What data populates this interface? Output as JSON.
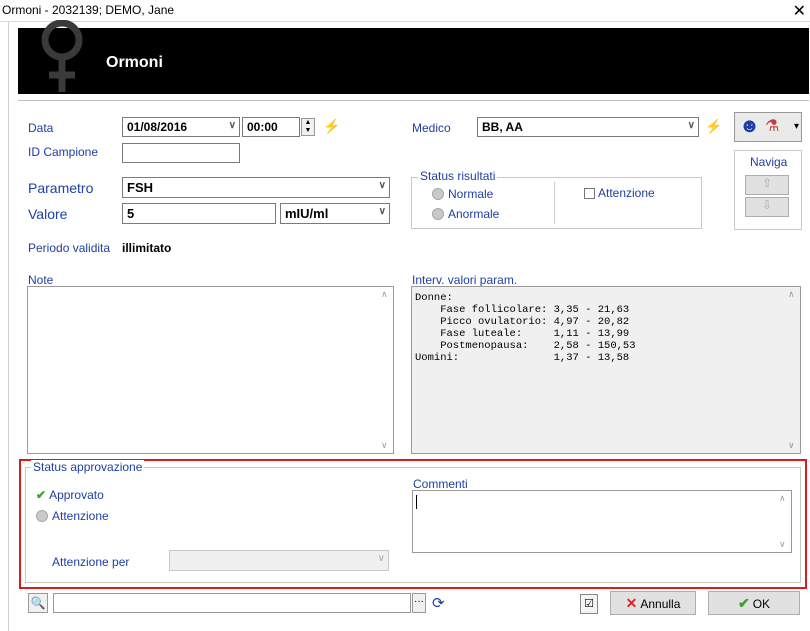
{
  "window": {
    "title": "Ormoni - 2032139; DEMO, Jane",
    "close_glyph": "✕"
  },
  "header": {
    "title": "Ormoni"
  },
  "form": {
    "data_label": "Data",
    "date_value": "01/08/2016",
    "time_value": "00:00",
    "id_campione_label": "ID Campione",
    "id_campione_value": "",
    "parametro_label": "Parametro",
    "parametro_value": "FSH",
    "valore_label": "Valore",
    "valore_value": "5",
    "unit_value": "mIU/ml",
    "periodo_label": "Periodo validita",
    "periodo_value": "illimitato",
    "medico_label": "Medico",
    "medico_value": "BB, AA"
  },
  "status_risultati": {
    "title": "Status risultati",
    "normale": "Normale",
    "anormale": "Anormale",
    "attenzione": "Attenzione"
  },
  "naviga": {
    "label": "Naviga"
  },
  "note": {
    "label": "Note"
  },
  "interv": {
    "label": "Interv. valori param.",
    "text": "Donne:\n    Fase follicolare: 3,35 - 21,63\n    Picco ovulatorio: 4,97 - 20,82\n    Fase luteale:     1,11 - 13,99\n    Postmenopausa:    2,58 - 150,53\nUomini:               1,37 - 13,58"
  },
  "approvazione": {
    "title": "Status approvazione",
    "approvato": "Approvato",
    "attenzione": "Attenzione",
    "attenzione_per_label": "Attenzione per",
    "commenti_label": "Commenti"
  },
  "footer": {
    "annulla": "Annulla",
    "ok": "OK"
  },
  "colors": {
    "label_blue": "#1f3fa3",
    "highlight_red": "#e0191f",
    "header_bg": "#000000"
  }
}
